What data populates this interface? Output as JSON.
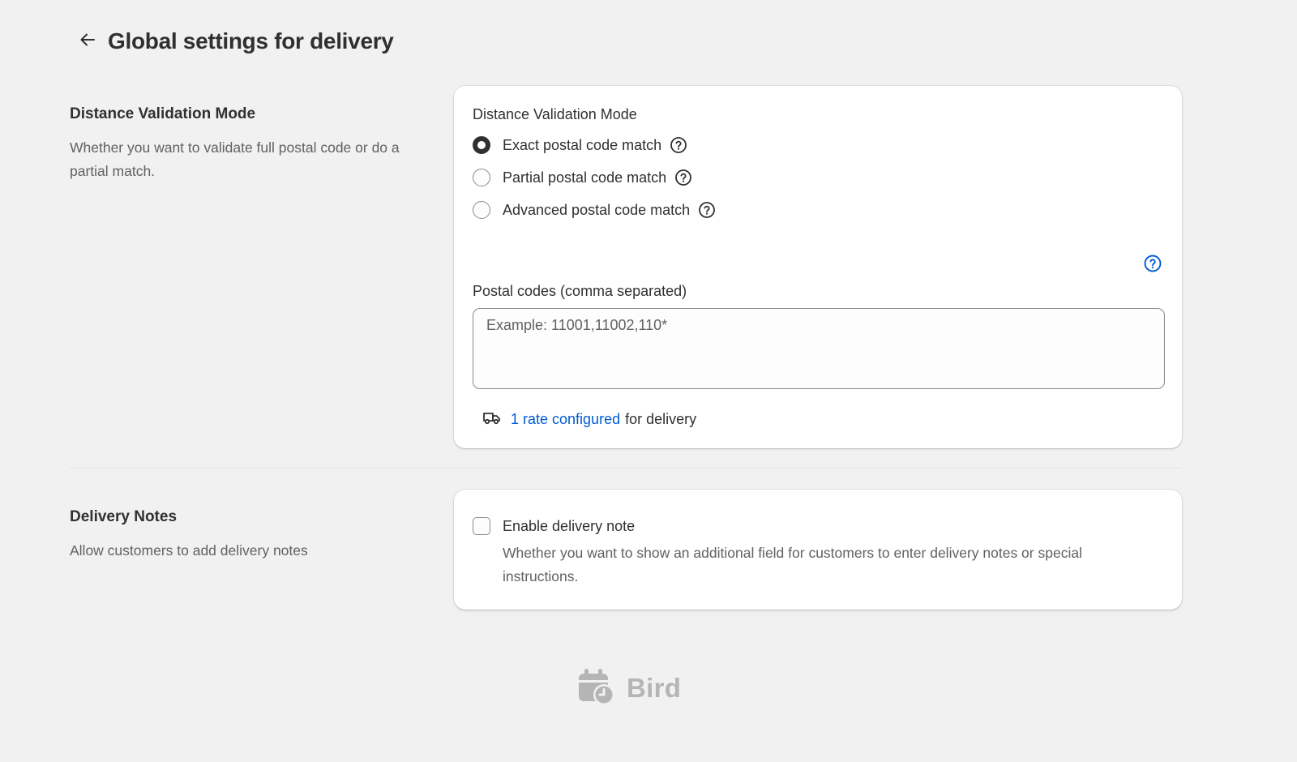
{
  "header": {
    "title": "Global settings for delivery",
    "back_icon": "arrow-left-icon"
  },
  "distance_section": {
    "title": "Distance Validation Mode",
    "description": "Whether you want to validate full postal code or do a partial match.",
    "card": {
      "label": "Distance Validation Mode",
      "options": [
        {
          "label": "Exact postal code match",
          "checked": true,
          "icon": "question-circle-icon"
        },
        {
          "label": "Partial postal code match",
          "checked": false,
          "icon": "question-circle-icon"
        },
        {
          "label": "Advanced postal code match",
          "checked": false,
          "icon": "question-circle-icon"
        }
      ],
      "help_icon": "question-circle-icon",
      "postal_codes": {
        "label": "Postal codes (comma separated)",
        "value": "",
        "placeholder": "Example: 11001,11002,110*"
      },
      "rate": {
        "icon": "delivery-truck-icon",
        "link_text": "1 rate configured",
        "suffix": "for delivery"
      }
    }
  },
  "notes_section": {
    "title": "Delivery Notes",
    "description": "Allow customers to add delivery notes",
    "card": {
      "checkbox_label": "Enable delivery note",
      "checked": false,
      "help_text": "Whether you want to show an additional field for customers to enter delivery notes or special instructions."
    }
  },
  "footer": {
    "logo_text": "Bird",
    "logo_icon": "calendar-clock-icon"
  },
  "colors": {
    "background": "#f1f1f1",
    "card": "#ffffff",
    "text": "#303030",
    "muted_text": "#616161",
    "link": "#005bd3",
    "logo": "#b5b5b5"
  }
}
